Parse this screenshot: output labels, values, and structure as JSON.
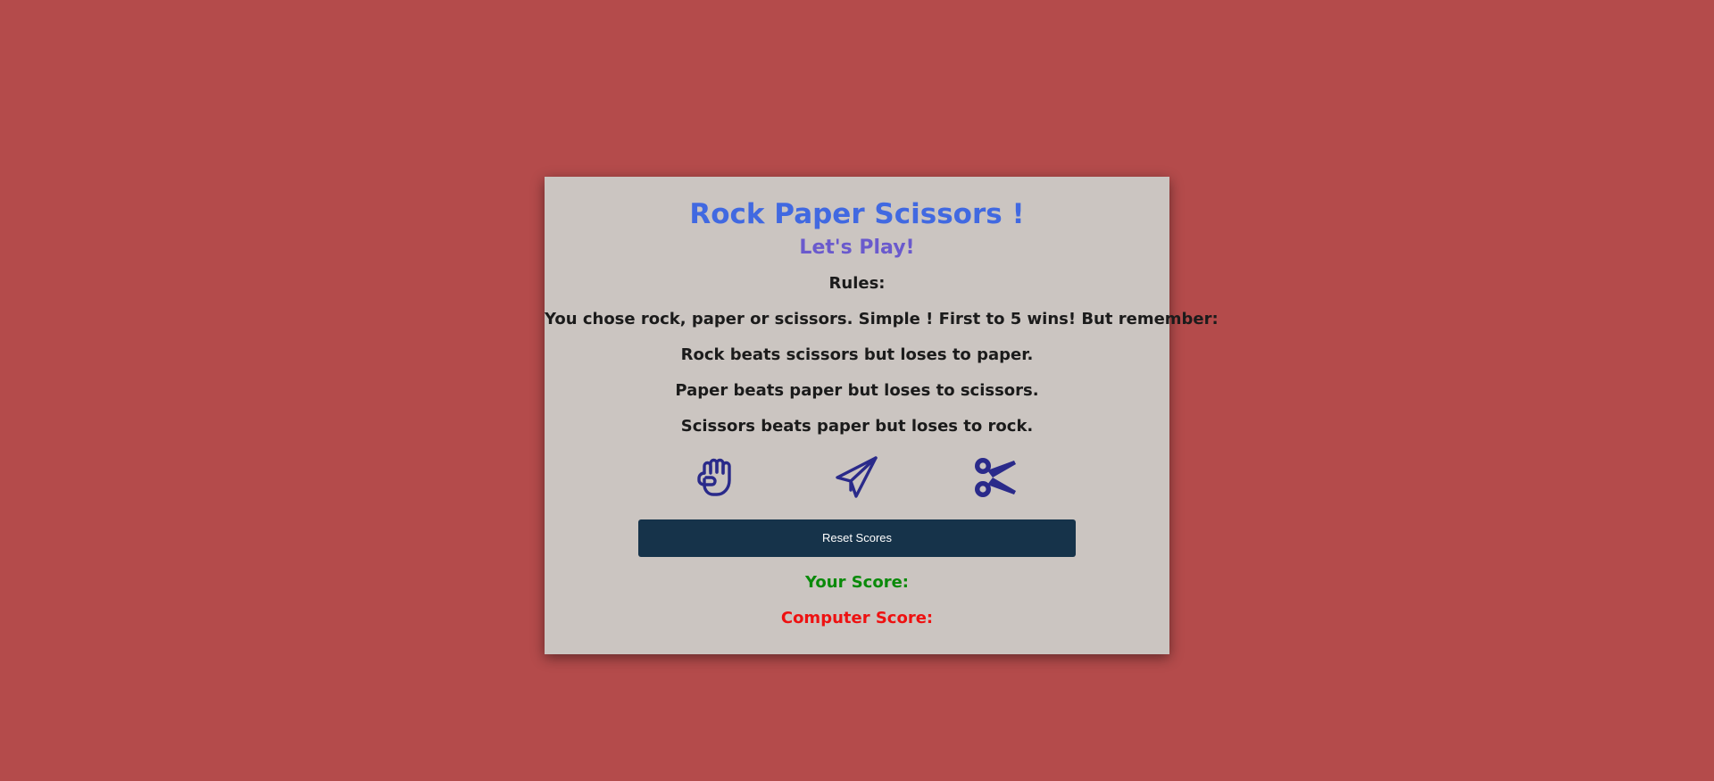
{
  "game": {
    "title": "Rock Paper Scissors !",
    "subtitle": "Let's Play!",
    "rules": [
      "Rules:",
      "You chose rock, paper or scissors. Simple ! First to 5 wins! But remember:",
      "Rock beats scissors but loses to paper.",
      "Paper beats paper but loses to scissors.",
      "Scissors beats paper but loses to rock."
    ],
    "choices": [
      {
        "name": "rock",
        "icon": "hand-fist-icon"
      },
      {
        "name": "paper",
        "icon": "paper-plane-icon"
      },
      {
        "name": "scissors",
        "icon": "scissors-icon"
      }
    ],
    "reset_label": "Reset Scores",
    "your_score_label": "Your Score:",
    "computer_score_label": "Computer Score:"
  },
  "colors": {
    "background": "#b44b4b",
    "card": "#cbc5c1",
    "title": "#4169e1",
    "subtitle": "#6a5acd",
    "icon": "#2a2a8a",
    "button": "#16334a",
    "your_score": "#0a8a0a",
    "computer_score": "#ee1111"
  }
}
